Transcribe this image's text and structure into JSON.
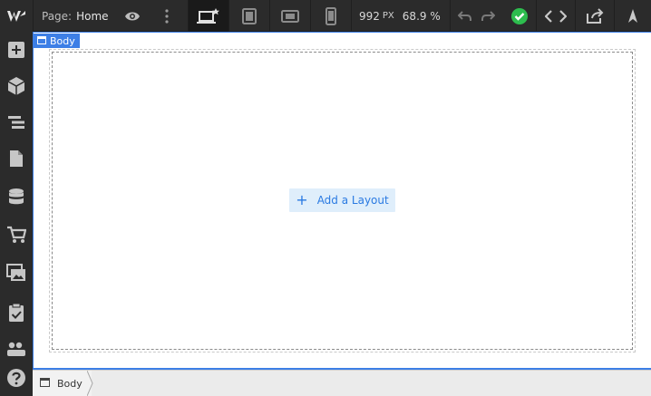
{
  "topbar": {
    "page_prefix": "Page:",
    "page_name": "Home",
    "width_value": "992",
    "width_unit": "PX",
    "zoom": "68.9 %"
  },
  "canvas": {
    "body_tag_label": "Body",
    "add_layout_label": "Add a Layout"
  },
  "breadcrumb": {
    "items": [
      "Body"
    ]
  },
  "colors": {
    "accent": "#3d7fe6",
    "success": "#2dbd4e",
    "toolbar_bg": "#2b2b2b"
  }
}
